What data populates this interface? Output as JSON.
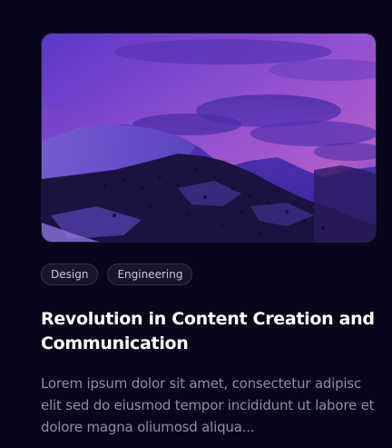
{
  "post": {
    "image_alt": "purple mountain landscape",
    "tags": [
      "Design",
      "Engineering"
    ],
    "title": "Revolution in Content Creation and Communication",
    "excerpt": "Lorem ipsum dolor sit amet, consectetur adipisc elit sed do eiusmod tempor incididunt ut labore et dolore magna oliumosd aliqua..."
  },
  "colors": {
    "background": "#07061a",
    "title": "#ffffff",
    "excerpt": "#8f8da4",
    "tag_border": "#34324b",
    "tag_bg": "#17152a",
    "tag_text": "#c9c8d6"
  }
}
